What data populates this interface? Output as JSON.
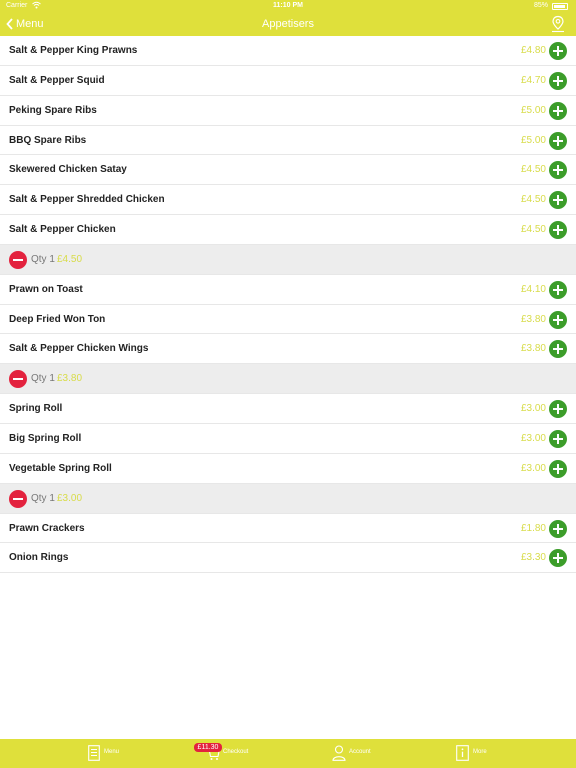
{
  "status_bar": {
    "carrier": "Carrier",
    "time": "11:10 PM",
    "battery": "85%"
  },
  "nav": {
    "back_label": "Menu",
    "title": "Appetisers"
  },
  "items": [
    {
      "type": "item",
      "name": "Salt & Pepper King Prawns",
      "price": "£4.80"
    },
    {
      "type": "item",
      "name": "Salt & Pepper Squid",
      "price": "£4.70"
    },
    {
      "type": "item",
      "name": "Peking Spare Ribs",
      "price": "£5.00"
    },
    {
      "type": "item",
      "name": "BBQ Spare Ribs",
      "price": "£5.00"
    },
    {
      "type": "item",
      "name": "Skewered Chicken Satay",
      "price": "£4.50"
    },
    {
      "type": "item",
      "name": "Salt & Pepper Shredded Chicken",
      "price": "£4.50"
    },
    {
      "type": "item",
      "name": "Salt & Pepper Chicken",
      "price": "£4.50"
    },
    {
      "type": "qty",
      "qty": "Qty 1",
      "price": "£4.50"
    },
    {
      "type": "item",
      "name": "Prawn on Toast",
      "price": "£4.10"
    },
    {
      "type": "item",
      "name": "Deep Fried Won Ton",
      "price": "£3.80"
    },
    {
      "type": "item",
      "name": "Salt & Pepper Chicken Wings",
      "price": "£3.80"
    },
    {
      "type": "qty",
      "qty": "Qty 1",
      "price": "£3.80"
    },
    {
      "type": "item",
      "name": "Spring Roll",
      "price": "£3.00"
    },
    {
      "type": "item",
      "name": "Big Spring Roll",
      "price": "£3.00"
    },
    {
      "type": "item",
      "name": "Vegetable Spring Roll",
      "price": "£3.00"
    },
    {
      "type": "qty",
      "qty": "Qty 1",
      "price": "£3.00"
    },
    {
      "type": "item",
      "name": "Prawn Crackers",
      "price": "£1.80"
    },
    {
      "type": "item",
      "name": "Onion Rings",
      "price": "£3.30"
    }
  ],
  "tabbar": {
    "tabs": [
      {
        "label": "Menu",
        "icon": "menu-icon"
      },
      {
        "label": "Checkout",
        "icon": "basket-icon"
      },
      {
        "label": "Account",
        "icon": "account-icon"
      },
      {
        "label": "More",
        "icon": "info-icon"
      }
    ],
    "basket_total": "£11.30"
  },
  "colors": {
    "accent": "#dfe03b",
    "add": "#3c9d2a",
    "remove": "#e3223e",
    "price": "#d8dc4a"
  }
}
